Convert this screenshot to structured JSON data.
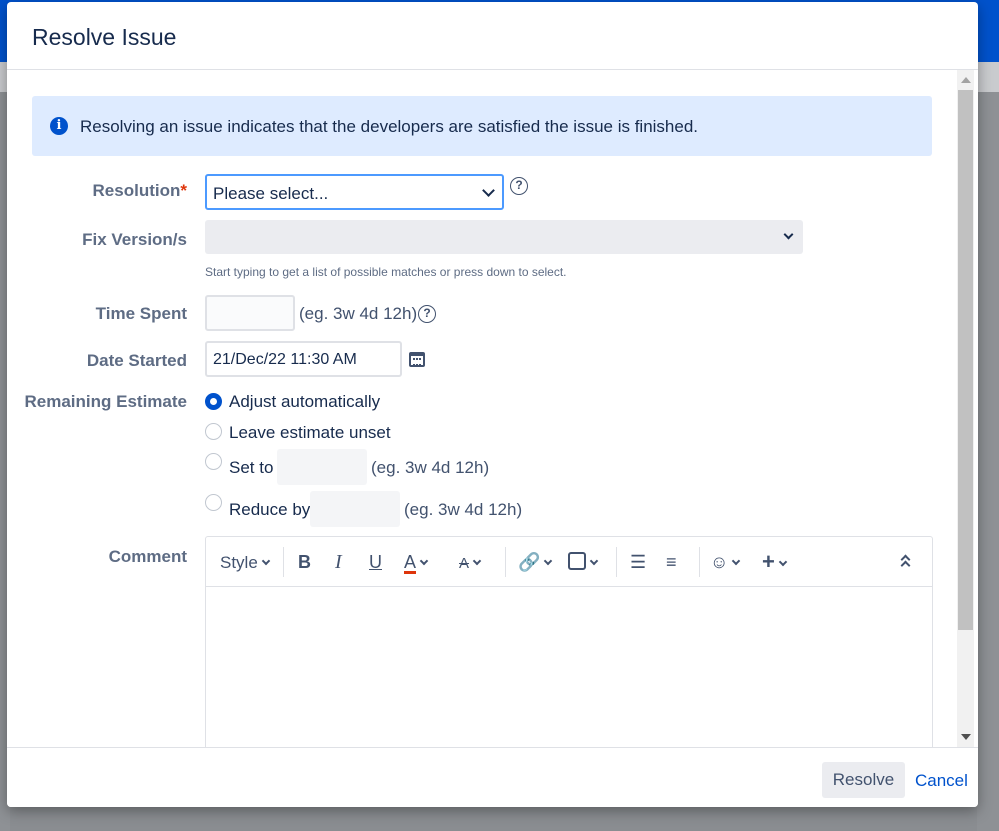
{
  "dialog": {
    "title": "Resolve Issue",
    "info_text": "Resolving an issue indicates that the developers are satisfied the issue is finished."
  },
  "form": {
    "resolution": {
      "label": "Resolution",
      "required_mark": "*",
      "value": "Please select..."
    },
    "fix_versions": {
      "label": "Fix Version/s",
      "value": "",
      "hint": "Start typing to get a list of possible matches or press down to select."
    },
    "time_spent": {
      "label": "Time Spent",
      "value": "",
      "example": "(eg. 3w 4d 12h)"
    },
    "date_started": {
      "label": "Date Started",
      "value": "21/Dec/22 11:30 AM"
    },
    "remaining_estimate": {
      "label": "Remaining Estimate",
      "selected": "Adjust automatically",
      "options": [
        {
          "label": "Adjust automatically"
        },
        {
          "label": "Leave estimate unset"
        },
        {
          "label": "Set to",
          "example": "(eg. 3w 4d 12h)"
        },
        {
          "label": "Reduce by",
          "example": "(eg. 3w 4d 12h)"
        }
      ]
    },
    "comment": {
      "label": "Comment",
      "toolbar": {
        "style_label": "Style",
        "bold": "B",
        "italic": "I",
        "underline": "U",
        "text_color": "A",
        "more_formatting": "A",
        "insert": "+"
      },
      "value": ""
    }
  },
  "footer": {
    "resolve_label": "Resolve",
    "cancel_label": "Cancel"
  },
  "colors": {
    "accent": "#0052cc",
    "info_bg": "#deebff",
    "required": "#de350b"
  }
}
